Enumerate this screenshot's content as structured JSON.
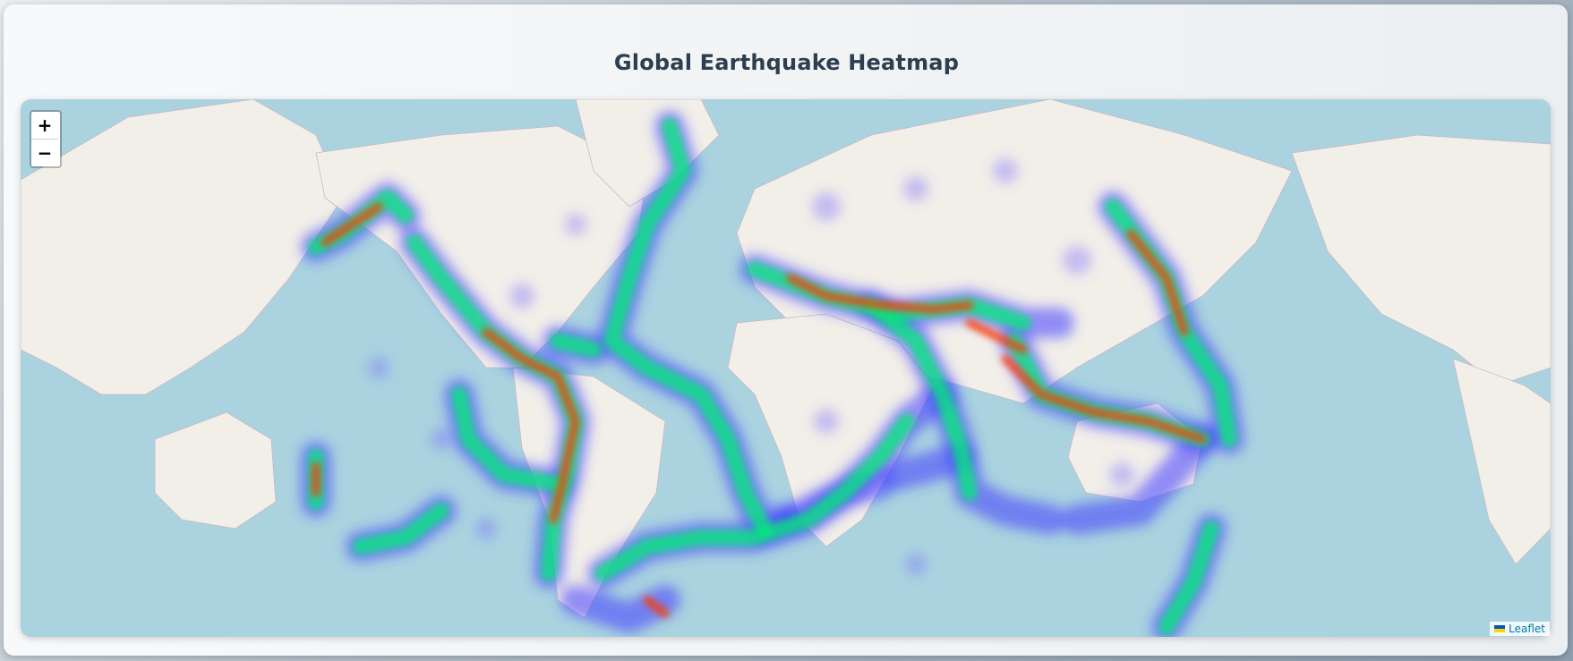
{
  "page": {
    "title": "Global Earthquake Heatmap"
  },
  "map": {
    "type": "heatmap",
    "basemap": "OpenStreetMap",
    "colors": {
      "water": "#aad3df",
      "land": "#f2efe9",
      "low": "#3f3cff",
      "mid": "#00ff88",
      "high": "#ff3000"
    }
  },
  "controls": {
    "zoom_in": "+",
    "zoom_out": "−"
  },
  "attribution": {
    "text": "Leaflet",
    "icon": "ukraine-flag-icon"
  }
}
